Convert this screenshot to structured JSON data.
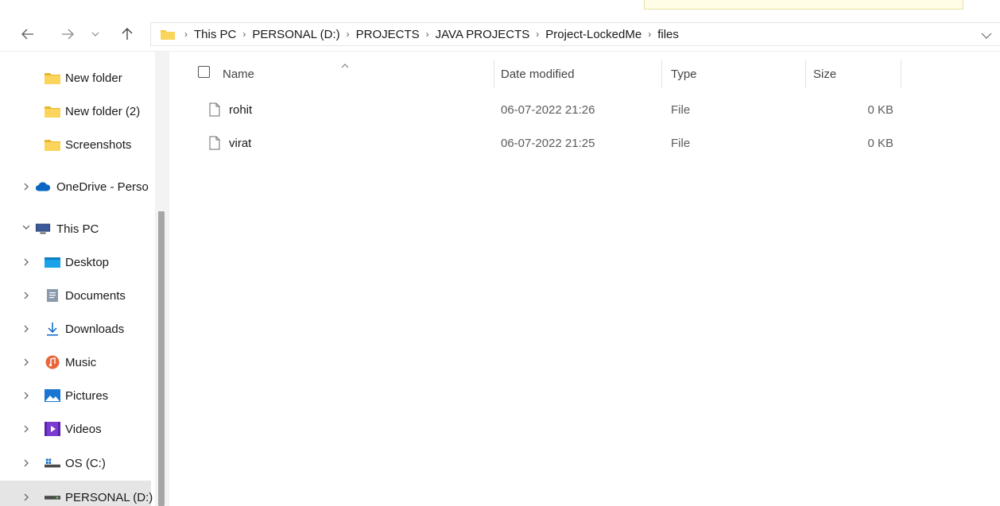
{
  "nav": {
    "back_icon": "back-arrow-icon",
    "forward_icon": "forward-arrow-icon",
    "recent_icon": "chevron-down-icon",
    "up_icon": "up-arrow-icon"
  },
  "address": {
    "crumbs": [
      "This PC",
      "PERSONAL (D:)",
      "PROJECTS",
      "JAVA PROJECTS",
      "Project-LockedMe",
      "files"
    ]
  },
  "sidebar": {
    "items": [
      {
        "label": "New folder",
        "icon": "folder-icon"
      },
      {
        "label": "New folder (2)",
        "icon": "folder-icon"
      },
      {
        "label": "Screenshots",
        "icon": "folder-icon"
      },
      {
        "label": "OneDrive - Perso",
        "icon": "cloud-icon"
      },
      {
        "label": "This PC",
        "icon": "computer-icon"
      },
      {
        "label": "Desktop",
        "icon": "desktop-icon"
      },
      {
        "label": "Documents",
        "icon": "documents-icon"
      },
      {
        "label": "Downloads",
        "icon": "download-icon"
      },
      {
        "label": "Music",
        "icon": "music-icon"
      },
      {
        "label": "Pictures",
        "icon": "pictures-icon"
      },
      {
        "label": "Videos",
        "icon": "videos-icon"
      },
      {
        "label": "OS (C:)",
        "icon": "drive-icon"
      },
      {
        "label": "PERSONAL (D:)",
        "icon": "drive-icon"
      }
    ]
  },
  "columns": {
    "name": "Name",
    "date": "Date modified",
    "type": "Type",
    "size": "Size"
  },
  "files": [
    {
      "name": "rohit",
      "date": "06-07-2022 21:26",
      "type": "File",
      "size": "0 KB"
    },
    {
      "name": "virat",
      "date": "06-07-2022 21:25",
      "type": "File",
      "size": "0 KB"
    }
  ],
  "colors": {
    "folder": "#f8c93c",
    "accent": "#0a66c2",
    "selected": "#e5e5e5"
  }
}
